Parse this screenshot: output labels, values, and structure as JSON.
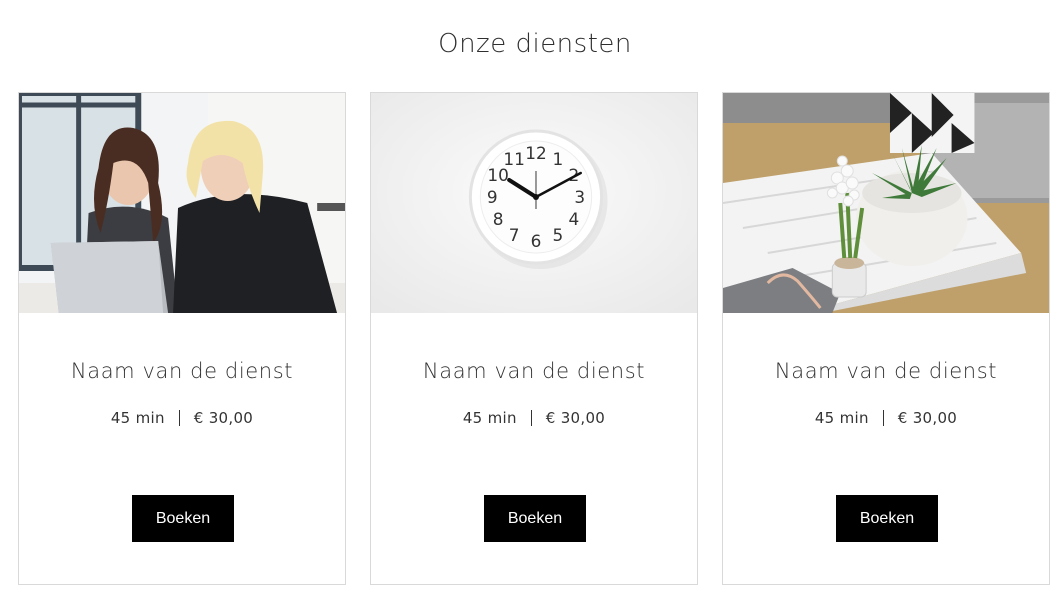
{
  "section": {
    "title": "Onze diensten"
  },
  "services": [
    {
      "name": "Naam van de dienst",
      "duration": "45 min",
      "price": "€ 30,00",
      "button": "Boeken",
      "image": "two-women-laptop-photo"
    },
    {
      "name": "Naam van de dienst",
      "duration": "45 min",
      "price": "€ 30,00",
      "button": "Boeken",
      "image": "wall-clock-photo"
    },
    {
      "name": "Naam van de dienst",
      "duration": "45 min",
      "price": "€ 30,00",
      "button": "Boeken",
      "image": "plants-on-white-table-photo"
    }
  ],
  "clock_numbers": [
    "12",
    "1",
    "2",
    "3",
    "4",
    "5",
    "6",
    "7",
    "8",
    "9",
    "10",
    "11"
  ],
  "colors": {
    "button_bg": "#000000",
    "button_text": "#ffffff",
    "card_border": "#d9d9d9"
  }
}
